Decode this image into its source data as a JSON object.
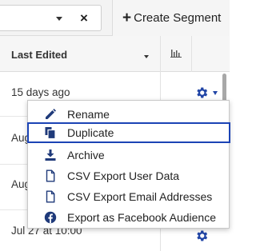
{
  "toolbar": {
    "filter_clear_label": "×",
    "create_plus": "+",
    "create_label": "Create Segment"
  },
  "table": {
    "header": {
      "last_edited": "Last Edited"
    },
    "rows": [
      {
        "last_edited": "15 days ago"
      },
      {
        "last_edited": "Aug"
      },
      {
        "last_edited": "Aug"
      },
      {
        "last_edited": "Jul 27 at 10:00"
      }
    ]
  },
  "menu": {
    "items": [
      {
        "label": "Rename",
        "icon": "pencil-icon"
      },
      {
        "label": "Duplicate",
        "icon": "duplicate-icon",
        "selected": true
      },
      {
        "label": "Archive",
        "icon": "archive-icon"
      },
      {
        "label": "CSV Export User Data",
        "icon": "file-icon"
      },
      {
        "label": "CSV Export Email Addresses",
        "icon": "file-icon"
      },
      {
        "label": "Export as Facebook Audience",
        "icon": "facebook-icon"
      }
    ]
  },
  "colors": {
    "accent": "#1b43b5",
    "gear": "#2145a6",
    "icon": "#1f3a7a",
    "toolbar_bg": "#f3f3f3"
  }
}
